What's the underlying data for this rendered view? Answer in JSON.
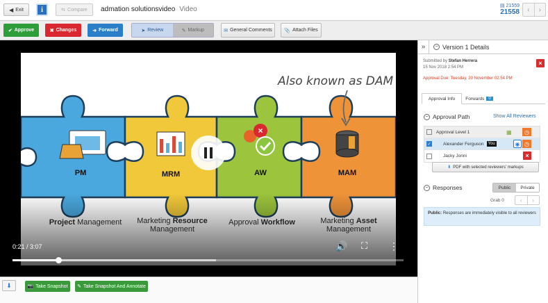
{
  "header": {
    "exit_label": "Exit",
    "info_icon": "info-icon",
    "compare_label": "Compare",
    "title": "admation solutionsvideo",
    "subtitle": "Video",
    "version_prev": "21559",
    "version_current": "21558"
  },
  "toolbar": {
    "approve_label": "Approve",
    "changes_label": "Changes",
    "forward_label": "Forward",
    "review_label": "Review",
    "markup_label": "Markup",
    "general_comments_label": "General Comments",
    "attach_files_label": "Attach Files"
  },
  "video": {
    "handwritten": "Also known as DAM",
    "pieces": [
      {
        "abbr": "PM",
        "caption_a": "Project",
        "caption_b": " Management",
        "caption_c": ""
      },
      {
        "abbr": "MRM",
        "caption_a": "Marketing ",
        "caption_b": "Resource",
        "caption_c": "Management"
      },
      {
        "abbr": "AW",
        "caption_a": "Approval ",
        "caption_b": "Workflow",
        "caption_c": ""
      },
      {
        "abbr": "MAM",
        "caption_a": "Marketing ",
        "caption_b": "Asset",
        "caption_c": "Management"
      }
    ],
    "time": "0:21 / 3:07",
    "played_fraction": 0.117,
    "buffered_fraction": 0.52
  },
  "bottom": {
    "take_snapshot_label": "Take Snapshot",
    "take_snapshot_annotate_label": "Take Snapshot And Annotate"
  },
  "sidebar": {
    "version_title": "Version 1 Details",
    "submitted_by_label": "Submitted by",
    "submitted_by": "Stefan Herrera",
    "submitted_at": "15 Nov 2018 2:54 PM",
    "approval_due": "Approval Due: Tuesday, 20 November 02:54 PM",
    "tab_approval_info": "Approval Info",
    "tab_forwards": "Forwards",
    "forwards_count": "0",
    "approval_path_label": "Approval Path",
    "show_all_reviewers": "Show All Reviewers",
    "approval_level": "Approval Level 1",
    "reviewers": [
      {
        "name": "Alexander Ferguson",
        "you": "You",
        "checked": true
      },
      {
        "name": "Jacky Jonni",
        "you": "",
        "checked": false
      }
    ],
    "pdf_button": "PDF with selected reviewers' markups",
    "responses_label": "Responses",
    "public_label": "Public",
    "private_label": "Private",
    "grab_label": "Grab 0",
    "public_note_bold": "Public:",
    "public_note": "Responses are immediately visible to all reviewers"
  },
  "colors": {
    "approve": "#2e9e3a",
    "changes": "#d9282f",
    "forward": "#2a7fc8",
    "piece_blue": "#4aa8de",
    "piece_yellow": "#f1c83a",
    "piece_green": "#9cc43c",
    "piece_orange": "#ef9339"
  }
}
